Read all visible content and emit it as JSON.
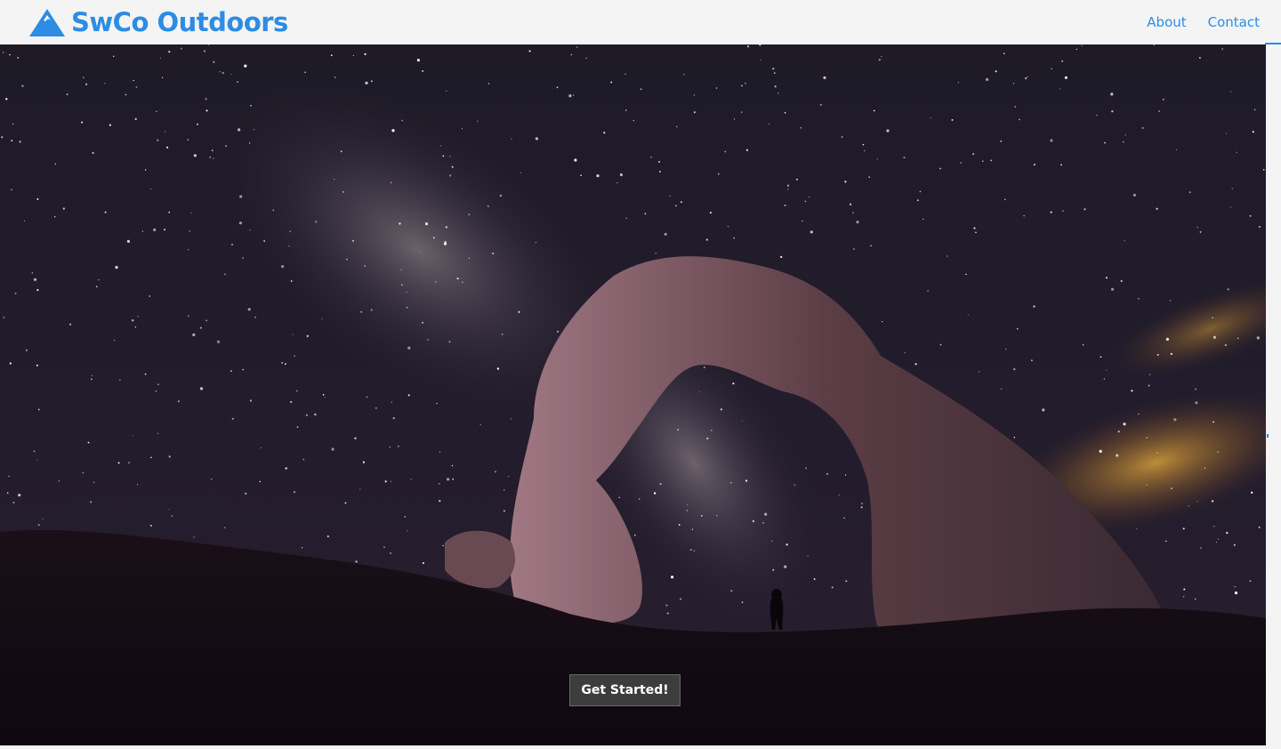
{
  "header": {
    "brand_name": "SwCo Outdoors",
    "brand_icon": "mountain-icon",
    "nav": [
      {
        "label": "About"
      },
      {
        "label": "Contact"
      }
    ]
  },
  "hero": {
    "background": "night-sky-arch-photo",
    "cta_label": "Get Started!"
  },
  "colors": {
    "brand": "#2d8ce3",
    "button_bg": "#3d3d3d",
    "page_bg": "#f4f4f4"
  }
}
